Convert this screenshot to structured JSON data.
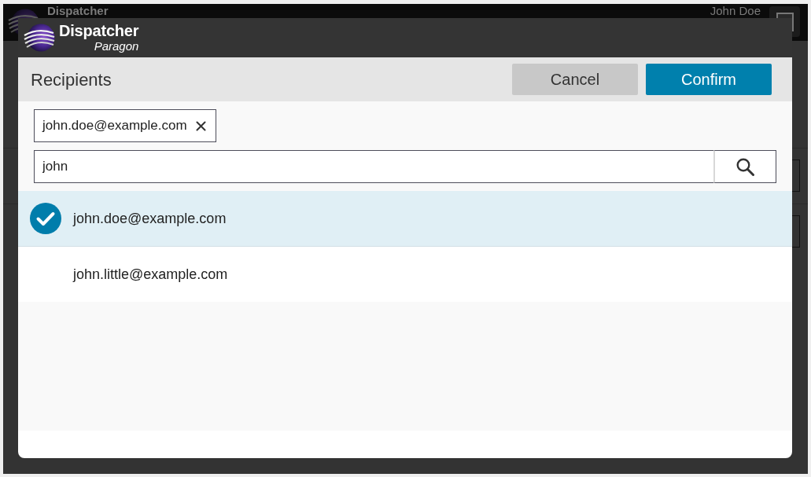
{
  "background_app": {
    "title": "Dispatcher",
    "user_name": "John Doe"
  },
  "dialog": {
    "brand": {
      "name": "Dispatcher",
      "product": "Paragon"
    },
    "title": "Recipients",
    "buttons": [
      {
        "label": "Cancel",
        "kind": "secondary"
      },
      {
        "label": "Confirm",
        "kind": "primary"
      }
    ],
    "chips": [
      {
        "label": "john.doe@example.com"
      }
    ],
    "search": {
      "value": "john"
    },
    "results": [
      {
        "email": "john.doe@example.com",
        "selected": true
      },
      {
        "email": "john.little@example.com",
        "selected": false
      }
    ]
  }
}
